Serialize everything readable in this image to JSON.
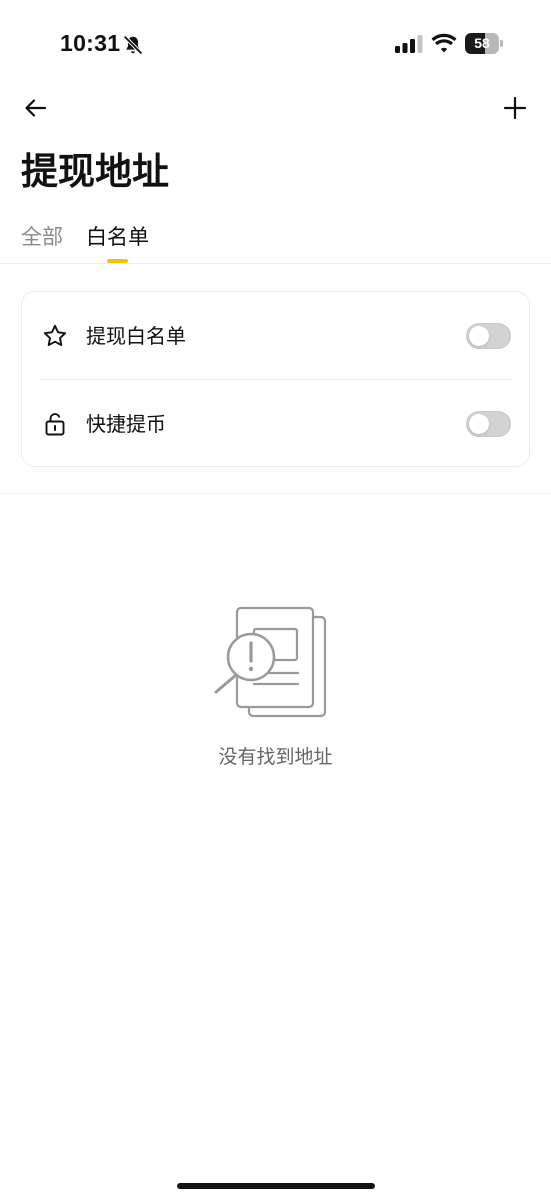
{
  "status_bar": {
    "time": "10:31",
    "battery_percent": "58",
    "battery_level": 0.58,
    "icons": [
      "mute-bell-icon",
      "cellular-signal-icon",
      "wifi-icon",
      "battery-icon"
    ]
  },
  "header": {
    "back_icon": "arrow-left-icon",
    "add_icon": "plus-icon",
    "title": "提现地址"
  },
  "tabs": [
    {
      "label": "全部",
      "active": false
    },
    {
      "label": "白名单",
      "active": true
    }
  ],
  "settings": [
    {
      "icon": "star-icon",
      "label": "提现白名单",
      "enabled": false
    },
    {
      "icon": "unlock-icon",
      "label": "快捷提币",
      "enabled": false
    }
  ],
  "empty_state": {
    "icon": "document-search-icon",
    "message": "没有找到地址"
  },
  "colors": {
    "accent": "#f0c400",
    "text_primary": "#111111",
    "text_secondary": "#8a8a8a",
    "toggle_off": "#d2d2d2"
  }
}
